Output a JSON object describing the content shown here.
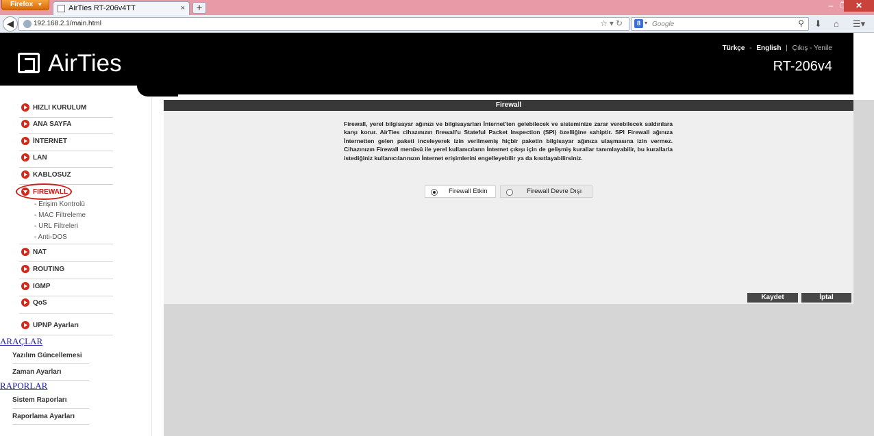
{
  "browser": {
    "menu_button": "Firefox",
    "tab_title": "AirTies RT-206v4TT",
    "new_tab": "+",
    "tab_close": "×",
    "url": "192.168.2.1/main.html",
    "search_placeholder": "Google",
    "search_engine_icon": "g-icon",
    "window": {
      "minimize": "–",
      "maximize": "❐",
      "close": "✕"
    }
  },
  "header": {
    "brand": "AirTies",
    "lang_tr": "Türkçe",
    "lang_en": "English",
    "lang_sep": "-",
    "divider": "|",
    "logout": "Çıkış - Yenile",
    "model": "RT-206v4"
  },
  "sidebar": {
    "items": [
      {
        "label": "HIZLI KURULUM"
      },
      {
        "label": "ANA SAYFA"
      },
      {
        "label": "İNTERNET"
      },
      {
        "label": "LAN"
      },
      {
        "label": "KABLOSUZ"
      },
      {
        "label": "FIREWALL"
      },
      {
        "label": "NAT"
      },
      {
        "label": "ROUTING"
      },
      {
        "label": "IGMP"
      },
      {
        "label": "QoS"
      },
      {
        "label": "UPNP Ayarları"
      }
    ],
    "firewall_sub": [
      "- Erişim Kontrolü",
      "- MAC Filtreleme",
      "- URL Filtreleri",
      "- Anti-DOS"
    ],
    "tools_header": "ARAÇLAR",
    "tools": [
      "Yazılım Güncellemesi",
      "Zaman Ayarları"
    ],
    "reports_header": "RAPORLAR",
    "reports": [
      "Sistem Raporları",
      "Raporlama Ayarları"
    ]
  },
  "main": {
    "title": "Firewall",
    "description": "Firewall, yerel bilgisayar ağınızı ve bilgisayarları İnternet'ten gelebilecek ve sisteminize zarar verebilecek saldırılara karşı korur. AirTies cihazınızın firewall'u Stateful Packet Inspection (SPI) özelliğine sahiptir. SPI Firewall ağınıza İnternetten gelen paketi inceleyerek izin verilmemiş hiçbir paketin bilgisayar ağınıza ulaşmasına izin vermez. Cihazınızın Firewall menüsü ile yerel kullanıcıların İnternet çıkışı için de gelişmiş kurallar tanımlayabilir, bu kurallarla istediğiniz kullanıcılarınızın İnternet erişimlerini engelleyebilir ya da kısıtlayabilirsiniz.",
    "radio_enabled": "Firewall Etkin",
    "radio_disabled": "Firewall Devre Dışı",
    "selected": "enabled",
    "save": "Kaydet",
    "cancel": "İptal"
  }
}
